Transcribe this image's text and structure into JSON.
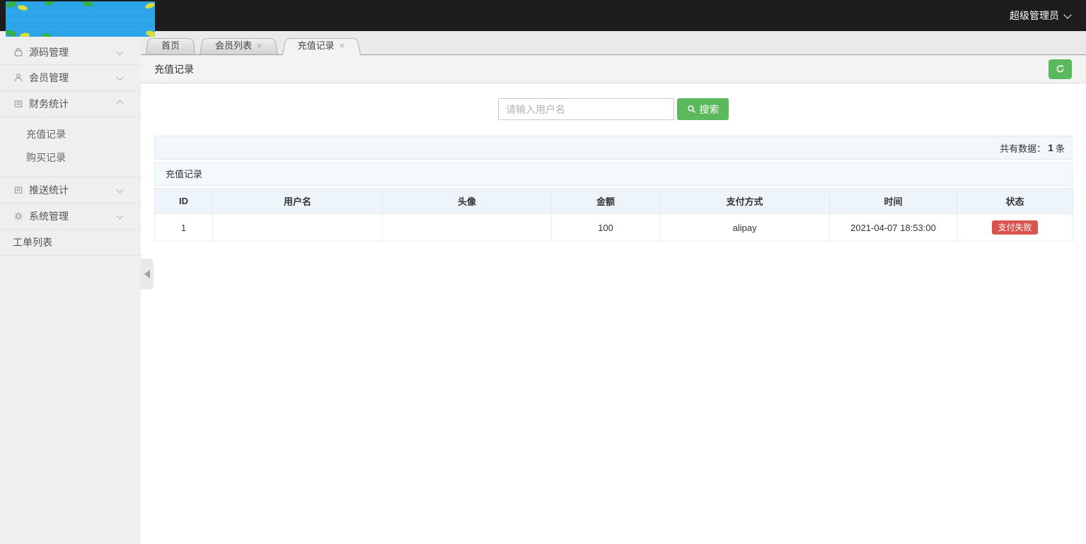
{
  "topbar": {
    "admin_label": "超级管理员"
  },
  "sidebar": {
    "items": [
      {
        "label": "源码管理",
        "icon": "bag-icon"
      },
      {
        "label": "会员管理",
        "icon": "user-icon"
      },
      {
        "label": "财务统计",
        "icon": "ledger-icon",
        "children": [
          "充值记录",
          "购买记录"
        ]
      },
      {
        "label": "推送统计",
        "icon": "ledger-icon"
      },
      {
        "label": "系统管理",
        "icon": "gear-icon"
      },
      {
        "label": "工单列表"
      }
    ]
  },
  "tabs": [
    {
      "label": "首页"
    },
    {
      "label": "会员列表",
      "close": "×"
    },
    {
      "label": "充值记录",
      "close": "×"
    }
  ],
  "page_title": "充值记录",
  "search": {
    "placeholder": "请输入用户名",
    "button": "搜索"
  },
  "stats": {
    "prefix": "共有数据：",
    "count": "1",
    "suffix": "条"
  },
  "panel": {
    "title": "充值记录"
  },
  "table": {
    "columns": [
      "ID",
      "用户名",
      "头像",
      "金额",
      "支付方式",
      "时间",
      "状态"
    ],
    "row": {
      "id": "1",
      "username": "",
      "avatar": "",
      "amount": "100",
      "pay_method": "alipay",
      "time": "2021-04-07 18:53:00",
      "status": "支付失败"
    }
  },
  "colors": {
    "accent_green": "#5cb85c",
    "status_danger": "#d9534f",
    "logo_blue": "#2ba4e8"
  }
}
